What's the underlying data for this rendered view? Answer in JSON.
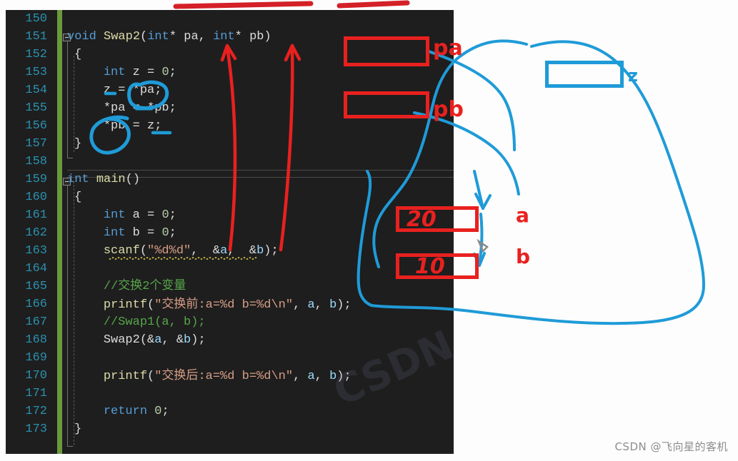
{
  "editor": {
    "language": "c",
    "theme_background": "#1e1e1e",
    "linenumber_color": "#2b91af",
    "margin_bar_color": "#6a9a3a",
    "lines": [
      {
        "no": "150",
        "text": ""
      },
      {
        "no": "151",
        "text": "void Swap2(int* pa, int* pb)"
      },
      {
        "no": "152",
        "text": "{"
      },
      {
        "no": "153",
        "text": "    int z = 0;"
      },
      {
        "no": "154",
        "text": "    z = *pa;"
      },
      {
        "no": "155",
        "text": "    *pa = *pb;"
      },
      {
        "no": "156",
        "text": "    *pb = z;"
      },
      {
        "no": "157",
        "text": "}"
      },
      {
        "no": "158",
        "text": ""
      },
      {
        "no": "159",
        "text": "int main()"
      },
      {
        "no": "160",
        "text": "{"
      },
      {
        "no": "161",
        "text": "    int a = 0;"
      },
      {
        "no": "162",
        "text": "    int b = 0;"
      },
      {
        "no": "163",
        "text": "    scanf(\"%d%d\", &a, &b);"
      },
      {
        "no": "164",
        "text": ""
      },
      {
        "no": "165",
        "text": "    //交换2个变量"
      },
      {
        "no": "166",
        "text": "    printf(\"交换前:a=%d b=%d\\n\", a, b);"
      },
      {
        "no": "167",
        "text": "    //Swap1(a, b);"
      },
      {
        "no": "168",
        "text": "    Swap2(&a, &b);"
      },
      {
        "no": "169",
        "text": ""
      },
      {
        "no": "170",
        "text": "    printf(\"交换后:a=%d b=%d\\n\", a, b);"
      },
      {
        "no": "171",
        "text": ""
      },
      {
        "no": "172",
        "text": "    return 0;"
      },
      {
        "no": "173",
        "text": "}"
      }
    ]
  },
  "annotations": {
    "red_color": "#e8211f",
    "blue_color": "#1f9bd8",
    "labels": {
      "pa": "pa",
      "pb": "pb",
      "a": "a",
      "b": "b",
      "z": "z"
    },
    "boxes": [
      {
        "name": "pa-memory-box",
        "color": "#e8211f",
        "value": ""
      },
      {
        "name": "pb-memory-box",
        "color": "#e8211f",
        "value": ""
      },
      {
        "name": "a-memory-box",
        "color": "#e8211f",
        "value": "20"
      },
      {
        "name": "b-memory-box",
        "color": "#e8211f",
        "value": "10"
      },
      {
        "name": "z-memory-box",
        "color": "#1f9bd8",
        "value": ""
      }
    ],
    "circled_tokens": [
      "*pa",
      "*pb"
    ],
    "underlined_tokens": [
      "z",
      "z"
    ],
    "arrow_sources": [
      "&a",
      "&b"
    ],
    "arrow_targets": [
      "pa",
      "pb"
    ]
  },
  "watermark": {
    "text": "CSDN @飞向星的客机",
    "ghost_text": "CSDN"
  }
}
